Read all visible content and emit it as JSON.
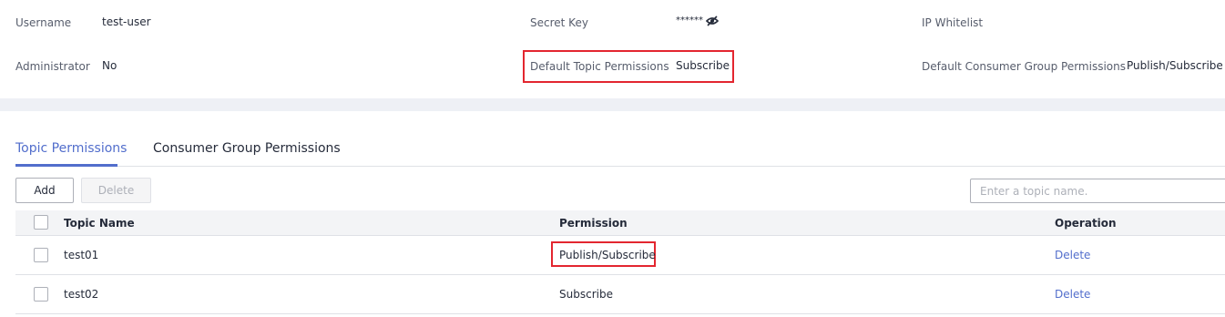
{
  "info": {
    "username_label": "Username",
    "username_value": "test-user",
    "secret_key_label": "Secret Key",
    "secret_key_value": "******",
    "ip_whitelist_label": "IP Whitelist",
    "administrator_label": "Administrator",
    "administrator_value": "No",
    "default_topic_perm_label": "Default Topic Permissions",
    "default_topic_perm_value": "Subscribe",
    "default_consumer_perm_label": "Default Consumer Group Permissions",
    "default_consumer_perm_value": "Publish/Subscribe",
    "secret_toggle_icon": "eye-off-icon"
  },
  "tabs": [
    {
      "label": "Topic Permissions",
      "active": true
    },
    {
      "label": "Consumer Group Permissions",
      "active": false
    }
  ],
  "toolbar": {
    "add_label": "Add",
    "delete_label": "Delete",
    "search_placeholder": "Enter a topic name."
  },
  "table": {
    "columns": [
      "Topic Name",
      "Permission",
      "Operation"
    ],
    "rows": [
      {
        "topic": "test01",
        "permission": "Publish/Subscribe",
        "operation": "Delete",
        "highlighted": true
      },
      {
        "topic": "test02",
        "permission": "Subscribe",
        "operation": "Delete",
        "highlighted": false
      }
    ]
  },
  "colors": {
    "accent": "#526ecc",
    "highlight_border": "#e3262f",
    "section_gap": "#eef0f5",
    "header_bg": "#f3f4f6"
  }
}
